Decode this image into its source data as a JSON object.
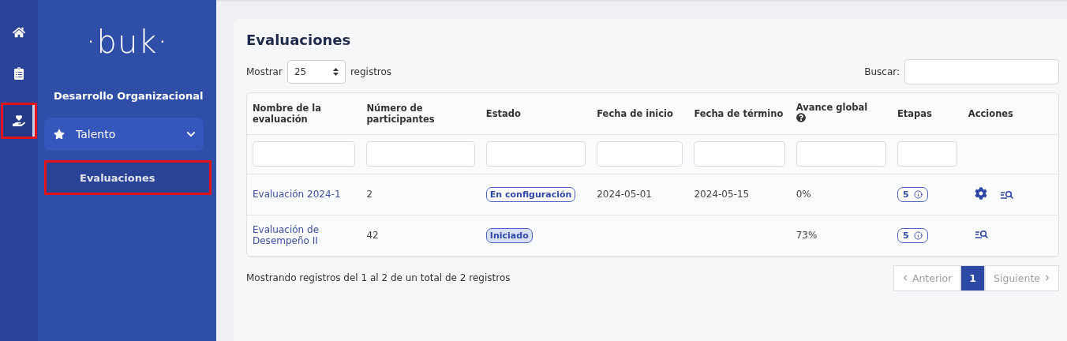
{
  "rail": [
    {
      "kind": "home",
      "selected": false,
      "highlighted": false
    },
    {
      "kind": "clipboard",
      "selected": false,
      "highlighted": false
    },
    {
      "kind": "care",
      "selected": true,
      "highlighted": true
    }
  ],
  "sidebar": {
    "logo": "·buk·",
    "section": "Desarrollo Organizacional",
    "group": {
      "label": "Talento",
      "expanded": true,
      "children": [
        {
          "label": "Evaluaciones",
          "selected": true,
          "highlighted": true
        }
      ]
    }
  },
  "card": {
    "title": "Evaluaciones",
    "show_label": "Mostrar",
    "page_size": "25",
    "records_label": "registros",
    "search_label": "Buscar:",
    "columns": [
      {
        "label": "Nombre de la evaluación",
        "kind": "filter"
      },
      {
        "label": "Número de participantes",
        "kind": "filter"
      },
      {
        "label": "Estado",
        "kind": "filter"
      },
      {
        "label": "Fecha de inicio",
        "kind": "filter"
      },
      {
        "label": "Fecha de término",
        "kind": "filter"
      },
      {
        "label": "Avance global",
        "kind": "help"
      },
      {
        "label": "Etapas",
        "kind": "filter"
      },
      {
        "label": "Acciones",
        "kind": "plain"
      }
    ],
    "rows": [
      {
        "name": "Evaluación 2024-1",
        "participants": "2",
        "status": {
          "label": "En configuración",
          "kind": "outline"
        },
        "start": "2024-05-01",
        "end": "2024-05-15",
        "progress": "0%",
        "stages": "5",
        "actions": [
          {
            "kind": "settings"
          },
          {
            "kind": "review"
          }
        ]
      },
      {
        "name": "Evaluación de Desempeño II",
        "participants": "42",
        "status": {
          "label": "Iniciado",
          "kind": "filled"
        },
        "start": "",
        "end": "",
        "progress": "73%",
        "stages": "5",
        "actions": [
          {
            "kind": "review"
          }
        ]
      }
    ],
    "summary": "Mostrando registros del 1 al 2 de un total de 2 registros",
    "pagination": {
      "previous": {
        "label": "Anterior",
        "disabled": true
      },
      "pages": [
        {
          "label": "1",
          "selected": true
        }
      ],
      "next": {
        "label": "Siguiente",
        "disabled": true
      }
    }
  }
}
